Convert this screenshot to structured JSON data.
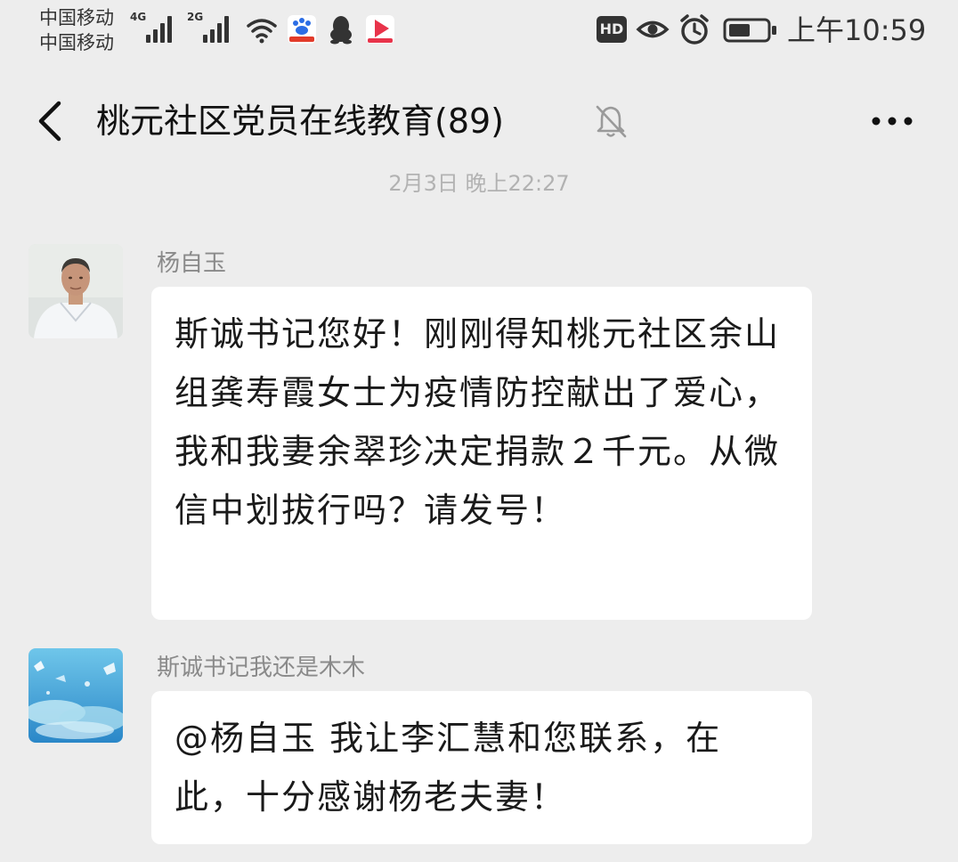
{
  "status_bar": {
    "carrier_1": "中国移动",
    "carrier_2": "中国移动",
    "network_1": "4G",
    "network_2": "2G",
    "hd_label": "HD",
    "time": "上午10:59",
    "icons": [
      "wifi-icon",
      "baidu-app-icon",
      "qq-icon",
      "video-app-icon",
      "eye-icon",
      "alarm-icon",
      "battery-icon"
    ]
  },
  "nav": {
    "title": "桃元社区党员在线教育(89)",
    "back_icon": "chevron-left-icon",
    "mute_icon": "bell-muted-icon",
    "more_icon": "more-dots-icon"
  },
  "chat": {
    "timestamp": "2月3日 晚上22:27",
    "messages": [
      {
        "sender": "杨自玉",
        "text": "斯诚书记您好！刚刚得知桃元社区余山组龚寿霞女士为疫情防控献出了爱心，我和我妻余翠珍决定捐款２千元。从微信中划拔行吗？请发号！"
      },
      {
        "sender": "斯诚书记我还是木木",
        "text": "@杨自玉  我让李汇慧和您联系，在此，十分感谢杨老夫妻！"
      }
    ]
  },
  "colors": {
    "background": "#ededed",
    "bubble": "#ffffff",
    "timestamp_text": "#b2b2b2",
    "sender_text": "#8a8a8a"
  }
}
